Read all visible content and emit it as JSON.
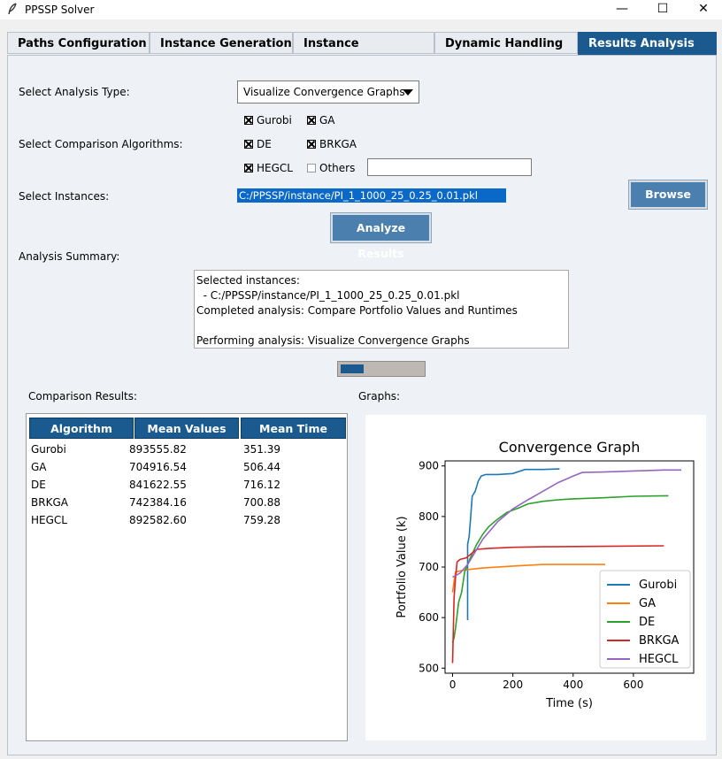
{
  "window": {
    "title": "PPSSP Solver",
    "minimize_glyph": "—",
    "maximize_glyph": "☐",
    "close_glyph": "✕"
  },
  "tabs": [
    {
      "label": "Paths Configuration"
    },
    {
      "label": "Instance Generation"
    },
    {
      "label": "Instance Optimization"
    },
    {
      "label": "Dynamic Handling"
    },
    {
      "label": "Results Analysis",
      "active": true
    }
  ],
  "form": {
    "analysis_type_label": "Select Analysis Type:",
    "analysis_type_value": "Visualize Convergence Graphs",
    "algorithms_label": "Select Comparison Algorithms:",
    "algorithms": [
      {
        "name": "Gurobi",
        "checked": true
      },
      {
        "name": "GA",
        "checked": true
      },
      {
        "name": "DE",
        "checked": true
      },
      {
        "name": "BRKGA",
        "checked": true
      },
      {
        "name": "HEGCL",
        "checked": true
      },
      {
        "name": "Others",
        "checked": false
      }
    ],
    "others_value": "",
    "instances_label": "Select Instances:",
    "instance_selected": "C:/PPSSP/instance/PI_1_1000_25_0.25_0.01.pkl",
    "browse_label": "Browse",
    "analyze_label": "Analyze Results"
  },
  "summary": {
    "label": "Analysis Summary:",
    "text": "Selected instances:\n  - C:/PPSSP/instance/PI_1_1000_25_0.25_0.01.pkl\nCompleted analysis: Compare Portfolio Values and Runtimes\n\nPerforming analysis: Visualize Convergence Graphs"
  },
  "progress": {
    "value_fraction": 0.28
  },
  "comparison": {
    "label": "Comparison Results:",
    "headers": [
      "Algorithm",
      "Mean Values",
      "Mean Time"
    ],
    "rows": [
      [
        "Gurobi",
        "893555.82",
        "351.39"
      ],
      [
        "GA",
        "704916.54",
        "506.44"
      ],
      [
        "DE",
        "841622.55",
        "716.12"
      ],
      [
        "BRKGA",
        "742384.16",
        "700.88"
      ],
      [
        "HEGCL",
        "892582.60",
        "759.28"
      ]
    ]
  },
  "graphs_label": "Graphs:",
  "colors": {
    "accent": "#1a5a8e",
    "button": "#4b7fae",
    "selection": "#0a68c8"
  },
  "chart_data": {
    "type": "line",
    "title": "Convergence Graph",
    "xlabel": "Time (s)",
    "ylabel": "Portfolio Value (k)",
    "xlim": [
      -25,
      800
    ],
    "ylim": [
      490,
      910
    ],
    "xticks": [
      0,
      200,
      400,
      600
    ],
    "yticks": [
      500,
      600,
      700,
      800,
      900
    ],
    "legend": "lower-right",
    "grid": false,
    "series": [
      {
        "name": "Gurobi",
        "color": "#1f77b4",
        "points": [
          [
            50,
            595
          ],
          [
            50,
            745
          ],
          [
            55,
            760
          ],
          [
            60,
            800
          ],
          [
            65,
            840
          ],
          [
            75,
            850
          ],
          [
            85,
            870
          ],
          [
            95,
            880
          ],
          [
            110,
            883
          ],
          [
            150,
            883
          ],
          [
            200,
            885
          ],
          [
            240,
            893
          ],
          [
            300,
            893
          ],
          [
            355,
            894
          ]
        ]
      },
      {
        "name": "GA",
        "color": "#ff7f0e",
        "points": [
          [
            0,
            650
          ],
          [
            5,
            672
          ],
          [
            10,
            690
          ],
          [
            30,
            693
          ],
          [
            50,
            695
          ],
          [
            100,
            698
          ],
          [
            200,
            702
          ],
          [
            300,
            705
          ],
          [
            400,
            705
          ],
          [
            506,
            705
          ]
        ]
      },
      {
        "name": "DE",
        "color": "#2ca02c",
        "points": [
          [
            0,
            550
          ],
          [
            5,
            560
          ],
          [
            10,
            580
          ],
          [
            20,
            630
          ],
          [
            30,
            650
          ],
          [
            40,
            690
          ],
          [
            50,
            705
          ],
          [
            60,
            720
          ],
          [
            80,
            745
          ],
          [
            100,
            765
          ],
          [
            120,
            780
          ],
          [
            150,
            795
          ],
          [
            180,
            808
          ],
          [
            220,
            817
          ],
          [
            250,
            825
          ],
          [
            300,
            830
          ],
          [
            350,
            833
          ],
          [
            400,
            835
          ],
          [
            500,
            837
          ],
          [
            600,
            840
          ],
          [
            716,
            841
          ]
        ]
      },
      {
        "name": "BRKGA",
        "color": "#d62728",
        "points": [
          [
            0,
            510
          ],
          [
            5,
            640
          ],
          [
            10,
            680
          ],
          [
            15,
            710
          ],
          [
            25,
            715
          ],
          [
            45,
            718
          ],
          [
            80,
            735
          ],
          [
            120,
            737
          ],
          [
            200,
            739
          ],
          [
            300,
            740
          ],
          [
            500,
            741
          ],
          [
            701,
            742
          ]
        ]
      },
      {
        "name": "HEGCL",
        "color": "#9467bd",
        "points": [
          [
            0,
            680
          ],
          [
            25,
            688
          ],
          [
            50,
            705
          ],
          [
            70,
            725
          ],
          [
            100,
            755
          ],
          [
            150,
            790
          ],
          [
            200,
            815
          ],
          [
            250,
            833
          ],
          [
            300,
            850
          ],
          [
            350,
            867
          ],
          [
            400,
            880
          ],
          [
            430,
            887
          ],
          [
            500,
            888
          ],
          [
            600,
            890
          ],
          [
            700,
            892
          ],
          [
            759,
            892
          ]
        ]
      }
    ]
  }
}
